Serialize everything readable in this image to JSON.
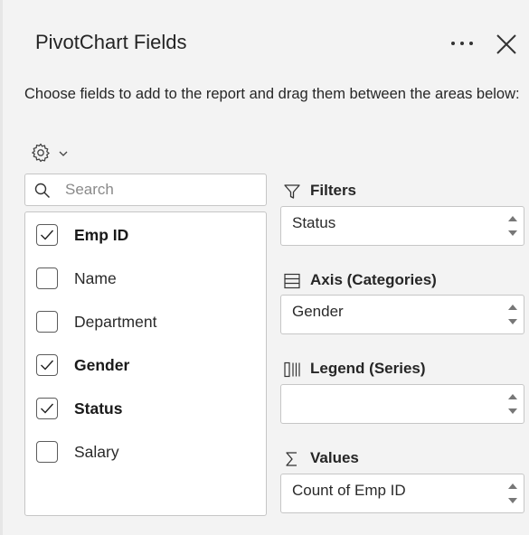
{
  "panel": {
    "title": "PivotChart Fields",
    "more_icon": "more-horizontal-icon",
    "close_icon": "close-icon",
    "description": "Choose fields to add to the report and drag them between the areas below:",
    "settings_icon": "gear-icon"
  },
  "search": {
    "placeholder": "Search",
    "value": ""
  },
  "fields": [
    {
      "label": "Emp ID",
      "checked": true
    },
    {
      "label": "Name",
      "checked": false
    },
    {
      "label": "Department",
      "checked": false
    },
    {
      "label": "Gender",
      "checked": true
    },
    {
      "label": "Status",
      "checked": true
    },
    {
      "label": "Salary",
      "checked": false
    }
  ],
  "areas": {
    "filters": {
      "label": "Filters",
      "icon": "filter-icon",
      "value": "Status"
    },
    "axis": {
      "label": "Axis (Categories)",
      "icon": "axis-rows-icon",
      "value": "Gender"
    },
    "legend": {
      "label": "Legend (Series)",
      "icon": "legend-columns-icon",
      "value": ""
    },
    "values": {
      "label": "Values",
      "icon": "sigma-icon",
      "value": "Count of Emp ID"
    }
  }
}
